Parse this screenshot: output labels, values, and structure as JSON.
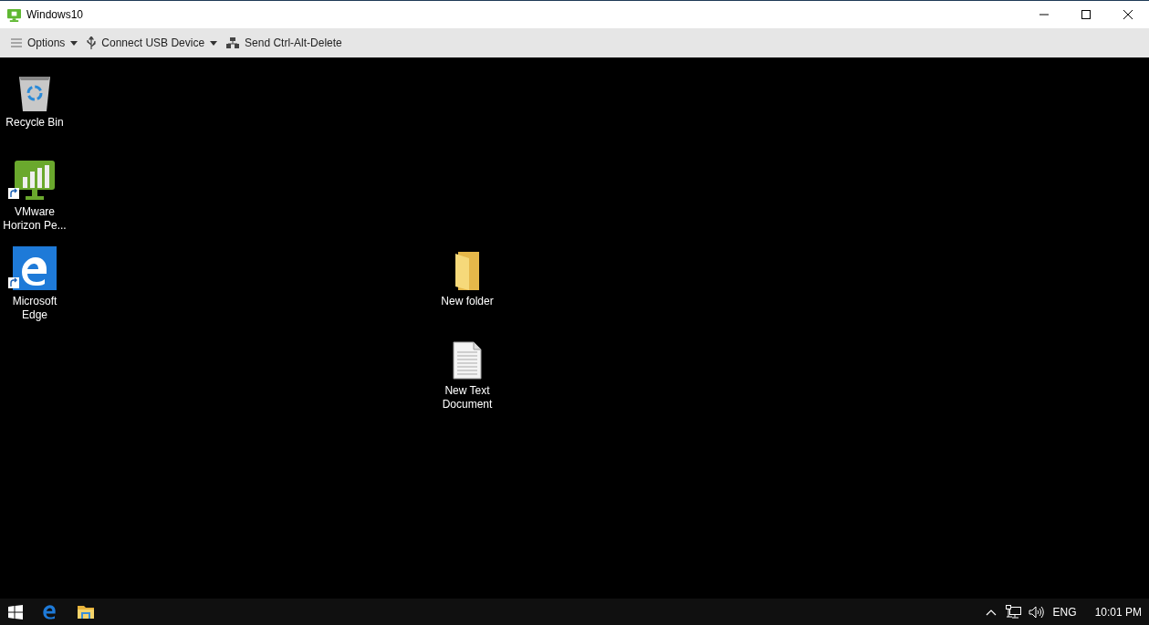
{
  "window": {
    "title": "Windows10"
  },
  "toolbar": [
    {
      "kind": "menu",
      "label": "Options",
      "dropdown": true
    },
    {
      "kind": "usb",
      "label": "Connect USB Device",
      "dropdown": true
    },
    {
      "kind": "cad",
      "label": "Send Ctrl-Alt-Delete",
      "dropdown": false
    }
  ],
  "desktop_icons": [
    {
      "kind": "recycle",
      "label": "Recycle Bin",
      "shortcut": false
    },
    {
      "kind": "horizon",
      "label": "VMware Horizon Pe...",
      "shortcut": true
    },
    {
      "kind": "edge",
      "label": "Microsoft Edge",
      "shortcut": true
    },
    {
      "kind": "folder",
      "label": "New folder",
      "shortcut": false
    },
    {
      "kind": "textdoc",
      "label": "New Text Document",
      "shortcut": false
    }
  ],
  "taskbar": {
    "apps": [
      {
        "kind": "start"
      },
      {
        "kind": "edge"
      },
      {
        "kind": "explorer"
      }
    ],
    "language": "ENG",
    "time": "10:01 PM"
  }
}
